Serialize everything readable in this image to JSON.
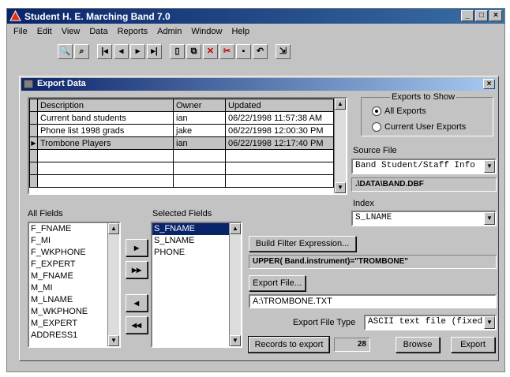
{
  "app": {
    "title": "Student H. E. Marching Band 7.0"
  },
  "menu": [
    "File",
    "Edit",
    "View",
    "Data",
    "Reports",
    "Admin",
    "Window",
    "Help"
  ],
  "toolbar_icons": [
    {
      "name": "search-icon",
      "glyph": "🔍"
    },
    {
      "name": "binoculars-icon",
      "glyph": "⌕"
    },
    {
      "name": "first-record-icon",
      "glyph": "|◂"
    },
    {
      "name": "prev-record-icon",
      "glyph": "◂"
    },
    {
      "name": "next-record-icon",
      "glyph": "▸"
    },
    {
      "name": "last-record-icon",
      "glyph": "▸|"
    },
    {
      "name": "new-record-icon",
      "glyph": "▯"
    },
    {
      "name": "copy-icon",
      "glyph": "⧉"
    },
    {
      "name": "delete-icon",
      "glyph": "✕"
    },
    {
      "name": "cut-icon",
      "glyph": "✂"
    },
    {
      "name": "save-icon",
      "glyph": "▪"
    },
    {
      "name": "undo-icon",
      "glyph": "↶"
    },
    {
      "name": "exit-icon",
      "glyph": "⇲"
    }
  ],
  "dialog": {
    "title": "Export Data",
    "grid": {
      "columns": [
        "Description",
        "Owner",
        "Updated"
      ],
      "rows": [
        {
          "description": "Current band students",
          "owner": "ian",
          "updated": "06/22/1998 11:57:38 AM",
          "selected": false
        },
        {
          "description": "Phone list 1998 grads",
          "owner": "jake",
          "updated": "06/22/1998 12:00:30 PM",
          "selected": false
        },
        {
          "description": "Trombone Players",
          "owner": "ian",
          "updated": "06/22/1998 12:17:40 PM",
          "selected": true
        }
      ],
      "empty_rows": 4
    },
    "exports_to_show": {
      "label": "Exports to Show",
      "options": [
        "All Exports",
        "Current User Exports"
      ],
      "selected": "All Exports"
    },
    "source_file": {
      "label": "Source File",
      "value": "Band Student/Staff Info",
      "path": ".\\DATA\\BAND.DBF"
    },
    "index": {
      "label": "Index",
      "value": "S_LNAME"
    },
    "all_fields": {
      "label": "All Fields",
      "items": [
        "F_FNAME",
        "F_MI",
        "F_WKPHONE",
        "F_EXPERT",
        "M_FNAME",
        "M_MI",
        "M_LNAME",
        "M_WKPHONE",
        "M_EXPERT",
        "ADDRESS1"
      ]
    },
    "selected_fields": {
      "label": "Selected Fields",
      "items": [
        "S_FNAME",
        "S_LNAME",
        "PHONE"
      ],
      "selected_index": 0
    },
    "move_buttons": {
      "add": "▸",
      "add_all": "▸▸",
      "remove": "◂",
      "remove_all": "◂◂"
    },
    "filter": {
      "button": "Build Filter Expression...",
      "expression": "UPPER( Band.instrument)=\"TROMBONE\""
    },
    "export_file": {
      "button": "Export File...",
      "value": "A:\\TROMBONE.TXT"
    },
    "export_file_type": {
      "label": "Export File Type",
      "value": "ASCII text file (fixed"
    },
    "records_to_export": {
      "button": "Records to export",
      "count": "28"
    },
    "browse_button": "Browse",
    "export_button": "Export"
  }
}
